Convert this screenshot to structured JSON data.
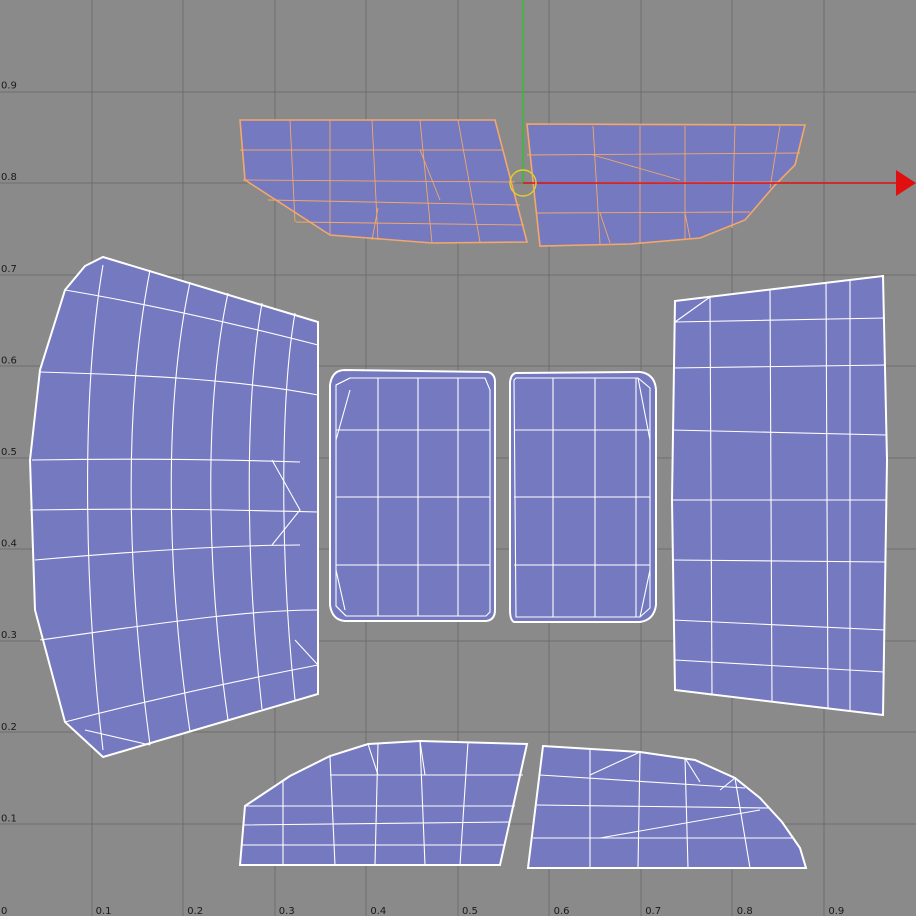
{
  "viewport": {
    "x_tick_labels": [
      "0",
      "0.1",
      "0.2",
      "0.3",
      "0.4",
      "0.5",
      "0.6",
      "0.7",
      "0.8",
      "0.9"
    ],
    "y_tick_labels": [
      "0.1",
      "0.2",
      "0.3",
      "0.4",
      "0.5",
      "0.6",
      "0.7",
      "0.8",
      "0.9"
    ]
  },
  "colors": {
    "background": "#8a8a8a",
    "grid_fine": "#6d6d6d",
    "grid_major": "#2a3fa0",
    "uv_fill": "#7479c0",
    "uv_edge": "#ffffff",
    "selected_edge": "#f2a86a",
    "manip_x_axis": "#e01010",
    "manip_y_axis": "#30c030",
    "manip_pivot": "#e8d020"
  },
  "uv_shells": [
    "top-left-shell",
    "top-right-shell",
    "left-panel-shell",
    "center-left-shell",
    "center-right-shell",
    "right-panel-shell",
    "bottom-left-shell",
    "bottom-right-shell"
  ],
  "selection": {
    "selected_shells": [
      "top-left-shell",
      "top-right-shell"
    ]
  },
  "manipulator": {
    "icons": [
      "move-x-arrow-icon",
      "move-y-axis-icon",
      "pivot-circle-icon"
    ]
  }
}
